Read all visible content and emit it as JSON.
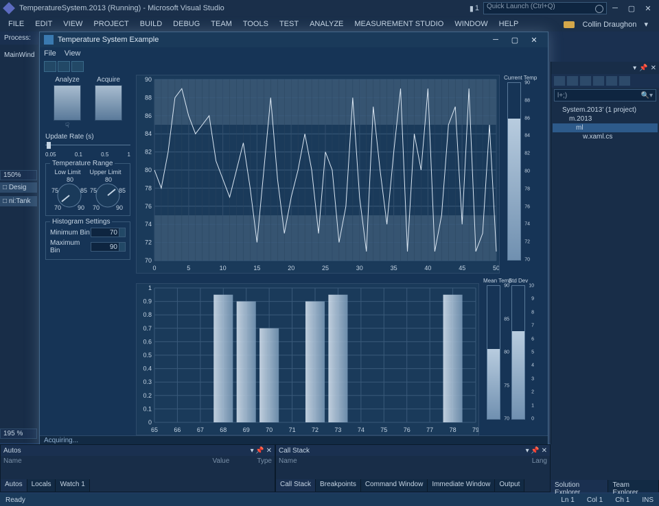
{
  "window": {
    "title": "TemperatureSystem.2013 (Running) - Microsoft Visual Studio",
    "notif_count": "1",
    "quick_launch_placeholder": "Quick Launch (Ctrl+Q)",
    "user": "Collin Draughon"
  },
  "menu": [
    "FILE",
    "EDIT",
    "VIEW",
    "PROJECT",
    "BUILD",
    "DEBUG",
    "TEAM",
    "TOOLS",
    "TEST",
    "ANALYZE",
    "MEASUREMENT STUDIO",
    "WINDOW",
    "HELP"
  ],
  "left": {
    "process_tab": "Process:",
    "mainwind": "MainWind",
    "zoom1": "150%",
    "design": "□ Desig",
    "tank": "□ ni:Tank",
    "zoom2": "195 %"
  },
  "child": {
    "title": "Temperature System Example",
    "menu": [
      "File",
      "View"
    ],
    "analyze": "Analyze",
    "acquire": "Acquire",
    "update_rate_label": "Update Rate (s)",
    "update_ticks": [
      "0.05",
      "0.1",
      "0.5",
      "1"
    ],
    "temp_range_label": "Temperature Range",
    "low_limit": "Low Limit",
    "upper_limit": "Upper Limit",
    "knob_ticks": [
      "70",
      "75",
      "80",
      "85",
      "90"
    ],
    "histo_label": "Histogram Settings",
    "min_bin_label": "Minimum Bin",
    "min_bin_value": "70",
    "max_bin_label": "Maximum Bin",
    "max_bin_value": "90",
    "current_temp_label": "Current Temp",
    "mean_temp_label": "Mean Temp",
    "std_dev_label": "Std Dev",
    "status": "Acquiring...",
    "gauge1": {
      "min": 70,
      "max": 90,
      "value": 86,
      "ticks": [
        "90",
        "88",
        "86",
        "84",
        "82",
        "80",
        "78",
        "76",
        "74",
        "72",
        "70"
      ]
    },
    "gauge_mean": {
      "min": 70,
      "max": 90,
      "value": 80.5,
      "ticks": [
        "90",
        "85",
        "80",
        "75",
        "70"
      ]
    },
    "gauge_std": {
      "min": 0,
      "max": 10,
      "value": 6.6,
      "ticks": [
        "10",
        "9",
        "8",
        "7",
        "6",
        "5",
        "4",
        "3",
        "2",
        "1",
        "0"
      ]
    }
  },
  "solution": {
    "search_placeholder": "l+;)",
    "root": "System.2013' (1 project)",
    "proj": "m.2013",
    "item_sel": "ml",
    "item2": "w.xaml.cs"
  },
  "autos": {
    "title": "Autos",
    "cols": [
      "Name",
      "Value",
      "Type"
    ],
    "tabs": [
      "Autos",
      "Locals",
      "Watch 1"
    ]
  },
  "callstack": {
    "title": "Call Stack",
    "cols": [
      "Name",
      "Lang"
    ],
    "tabs": [
      "Call Stack",
      "Breakpoints",
      "Command Window",
      "Immediate Window",
      "Output"
    ]
  },
  "right_tabs": [
    "Solution Explorer",
    "Team Explorer"
  ],
  "status": {
    "ready": "Ready",
    "ln": "Ln 1",
    "col": "Col 1",
    "ch": "Ch 1",
    "ins": "INS"
  },
  "chart_data": [
    {
      "type": "line",
      "title": "",
      "xlabel": "",
      "ylabel": "",
      "xlim": [
        0,
        50
      ],
      "ylim": [
        70,
        90
      ],
      "x": [
        0,
        1,
        2,
        3,
        4,
        5,
        6,
        7,
        8,
        9,
        10,
        11,
        12,
        13,
        14,
        15,
        16,
        17,
        18,
        19,
        20,
        21,
        22,
        23,
        24,
        25,
        26,
        27,
        28,
        29,
        30,
        31,
        32,
        33,
        34,
        35,
        36,
        37,
        38,
        39,
        40,
        41,
        42,
        43,
        44,
        45,
        46,
        47,
        48,
        49,
        50
      ],
      "values": [
        80,
        78,
        82,
        88,
        89,
        86,
        84,
        85,
        86,
        81,
        79,
        77,
        80,
        83,
        78,
        72,
        80,
        88,
        79,
        73,
        77,
        80,
        84,
        80,
        73,
        82,
        80,
        72,
        76,
        88,
        77,
        71,
        87,
        80,
        74,
        82,
        89,
        71,
        84,
        80,
        89,
        71,
        75,
        85,
        87,
        74,
        89,
        71,
        73,
        85,
        71
      ],
      "bands": [
        {
          "y0": 85,
          "y1": 90
        },
        {
          "y0": 70,
          "y1": 75
        }
      ]
    },
    {
      "type": "bar",
      "title": "",
      "xlabel": "",
      "ylabel": "",
      "xlim": [
        65,
        79
      ],
      "ylim": [
        0,
        1
      ],
      "categories": [
        65,
        66,
        67,
        68,
        69,
        70,
        71,
        72,
        73,
        74,
        75,
        76,
        77,
        78,
        79
      ],
      "values": [
        0,
        0,
        0,
        0.95,
        0.9,
        0.7,
        0,
        0.9,
        0.95,
        0,
        0,
        0,
        0,
        0.95,
        0
      ]
    }
  ]
}
